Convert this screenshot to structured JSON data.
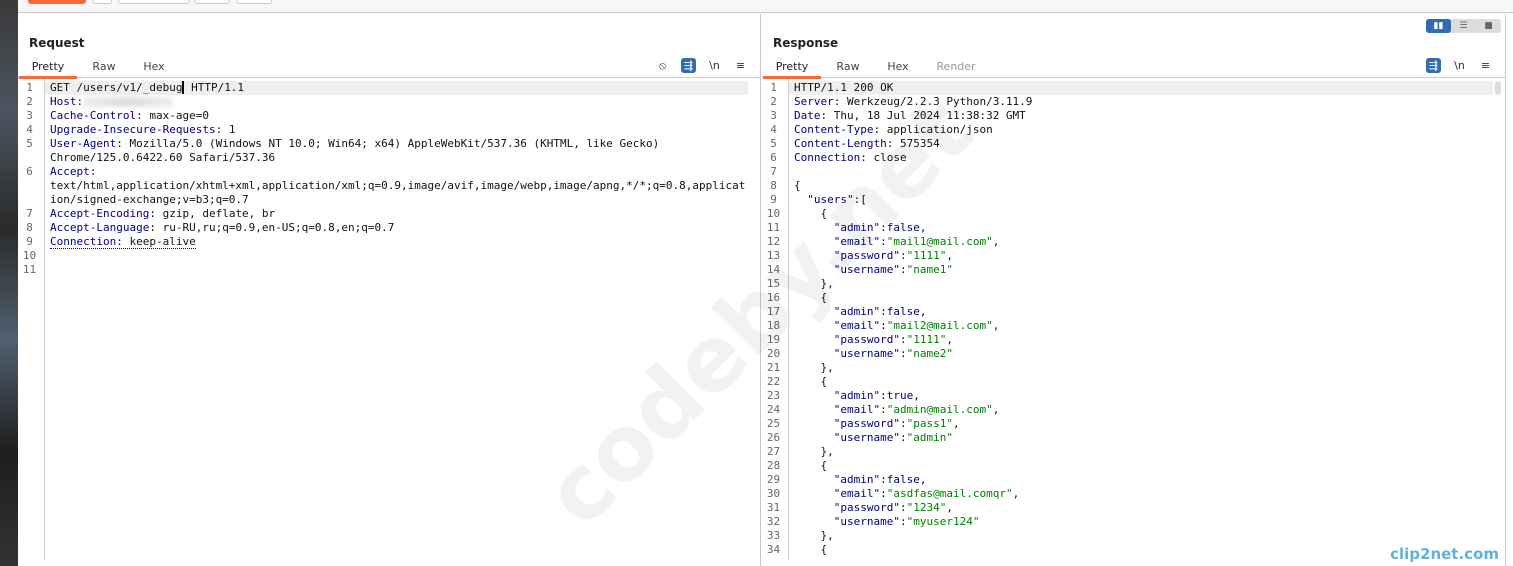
{
  "request": {
    "title": "Request",
    "tabs": [
      "Pretty",
      "Raw",
      "Hex"
    ],
    "active_tab": "Pretty",
    "lines": [
      {
        "n": "1",
        "plain": "GET /users/v1/_debug",
        "rest": " HTTP/1.1"
      },
      {
        "n": "2",
        "key": "Host",
        "val": ""
      },
      {
        "n": "3",
        "key": "Cache-Control",
        "val": " max-age=0"
      },
      {
        "n": "4",
        "key": "Upgrade-Insecure-Requests",
        "val": " 1"
      },
      {
        "n": "5",
        "key": "User-Agent",
        "val": " Mozilla/5.0 (Windows NT 10.0; Win64; x64) AppleWebKit/537.36 (KHTML, like Gecko) Chrome/125.0.6422.60 Safari/537.36"
      },
      {
        "n": "6",
        "key": "Accept",
        "val": " text/html,application/xhtml+xml,application/xml;q=0.9,image/avif,image/webp,image/apng,*/*;q=0.8,application/signed-exchange;v=b3;q=0.7"
      },
      {
        "n": "7",
        "key": "Accept-Encoding",
        "val": " gzip, deflate, br"
      },
      {
        "n": "8",
        "key": "Accept-Language",
        "val": " ru-RU,ru;q=0.9,en-US;q=0.8,en;q=0.7"
      },
      {
        "n": "9",
        "key": "Connection",
        "val": " keep-alive",
        "dotted": true
      },
      {
        "n": "10",
        "plain": ""
      },
      {
        "n": "11",
        "plain": ""
      }
    ]
  },
  "response": {
    "title": "Response",
    "tabs": [
      "Pretty",
      "Raw",
      "Hex",
      "Render"
    ],
    "active_tab": "Pretty",
    "headers": [
      {
        "n": "1",
        "plain": "HTTP/1.1 200 OK"
      },
      {
        "n": "2",
        "key": "Server",
        "val": " Werkzeug/2.2.3 Python/3.11.9"
      },
      {
        "n": "3",
        "key": "Date",
        "val": " Thu, 18 Jul 2024 11:38:32 GMT"
      },
      {
        "n": "4",
        "key": "Content-Type",
        "val": " application/json"
      },
      {
        "n": "5",
        "key": "Content-Length",
        "val": " 575354"
      },
      {
        "n": "6",
        "key": "Connection",
        "val": " close"
      },
      {
        "n": "7",
        "plain": ""
      }
    ],
    "body": [
      "{",
      "  \"users\":[",
      "    {",
      "      \"admin\":false,",
      "      \"email\":\"mail1@mail.com\",",
      "      \"password\":\"1111\",",
      "      \"username\":\"name1\"",
      "    },",
      "    {",
      "      \"admin\":false,",
      "      \"email\":\"mail2@mail.com\",",
      "      \"password\":\"1111\",",
      "      \"username\":\"name2\"",
      "    },",
      "    {",
      "      \"admin\":true,",
      "      \"email\":\"admin@mail.com\",",
      "      \"password\":\"pass1\",",
      "      \"username\":\"admin\"",
      "    },",
      "    {",
      "      \"admin\":false,",
      "      \"email\":\"asdfas@mail.comqr\",",
      "      \"password\":\"1234\",",
      "      \"username\":\"myuser124\"",
      "    },",
      "    {"
    ],
    "body_start_line": 8
  },
  "toolbar_icons": {
    "hide": "⦸",
    "wrap": "⇶",
    "newline": "\\n",
    "menu": "≡"
  },
  "watermark": "codeby.net",
  "clip_logo": "clip2net.com",
  "colors": {
    "accent": "#ff6633",
    "blue": "#2f6cb3",
    "key": "#000080",
    "string": "#008000"
  }
}
